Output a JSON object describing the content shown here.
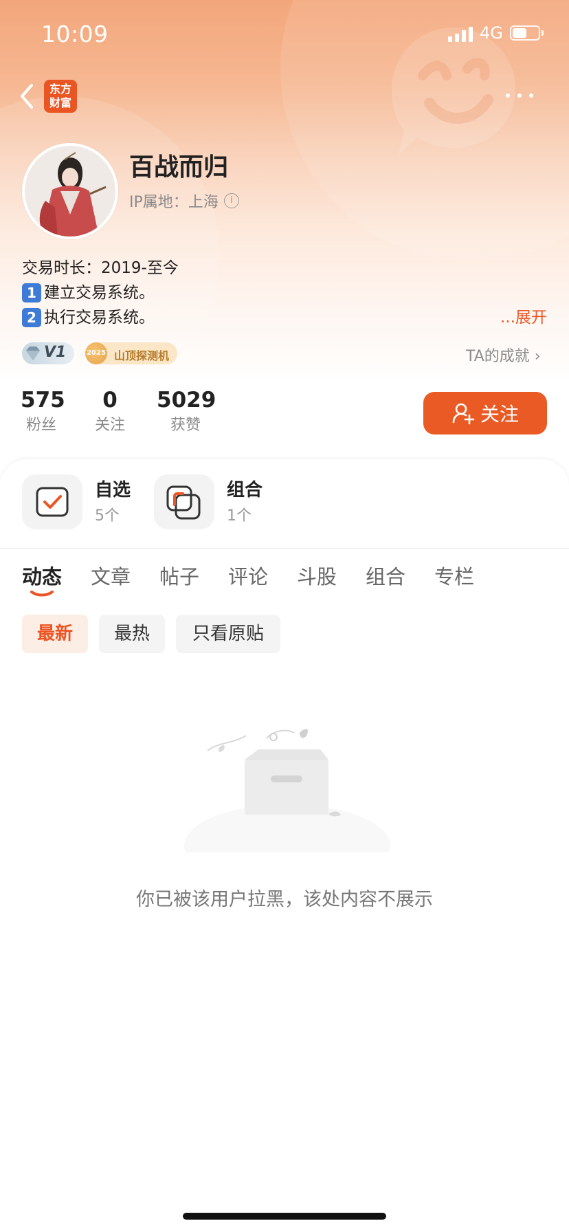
{
  "status_bar": {
    "time": "10:09",
    "network": "4G"
  },
  "nav": {
    "brand_logo": [
      "东方",
      "财富"
    ]
  },
  "profile": {
    "name": "百战而归",
    "ip_location": "IP属地：上海",
    "bio": {
      "line1": "交易时长：2019-至今",
      "line2_key": "1",
      "line2": "建立交易系统。",
      "line3_key": "2",
      "line3": "执行交易系统。"
    },
    "expand_label": "...展开",
    "badges": {
      "level": "V1",
      "peak_year": "2025",
      "peak_label": "山顶探测机"
    },
    "achievements_label": "TA的成就 ›"
  },
  "stats": [
    {
      "value": "575",
      "label": "粉丝"
    },
    {
      "value": "0",
      "label": "关注"
    },
    {
      "value": "5029",
      "label": "获赞"
    }
  ],
  "follow_button": {
    "label": "关注"
  },
  "assets": [
    {
      "title": "自选",
      "count": "5个"
    },
    {
      "title": "组合",
      "count": "1个"
    }
  ],
  "tabs": [
    "动态",
    "文章",
    "帖子",
    "评论",
    "斗股",
    "组合",
    "专栏"
  ],
  "active_tab": "动态",
  "filters": [
    "最新",
    "最热",
    "只看原贴"
  ],
  "active_filter": "最新",
  "empty_message": "你已被该用户拉黑，该处内容不展示",
  "colors": {
    "accent": "#ea5524",
    "text": "#222222",
    "muted": "#8a8a8a"
  }
}
